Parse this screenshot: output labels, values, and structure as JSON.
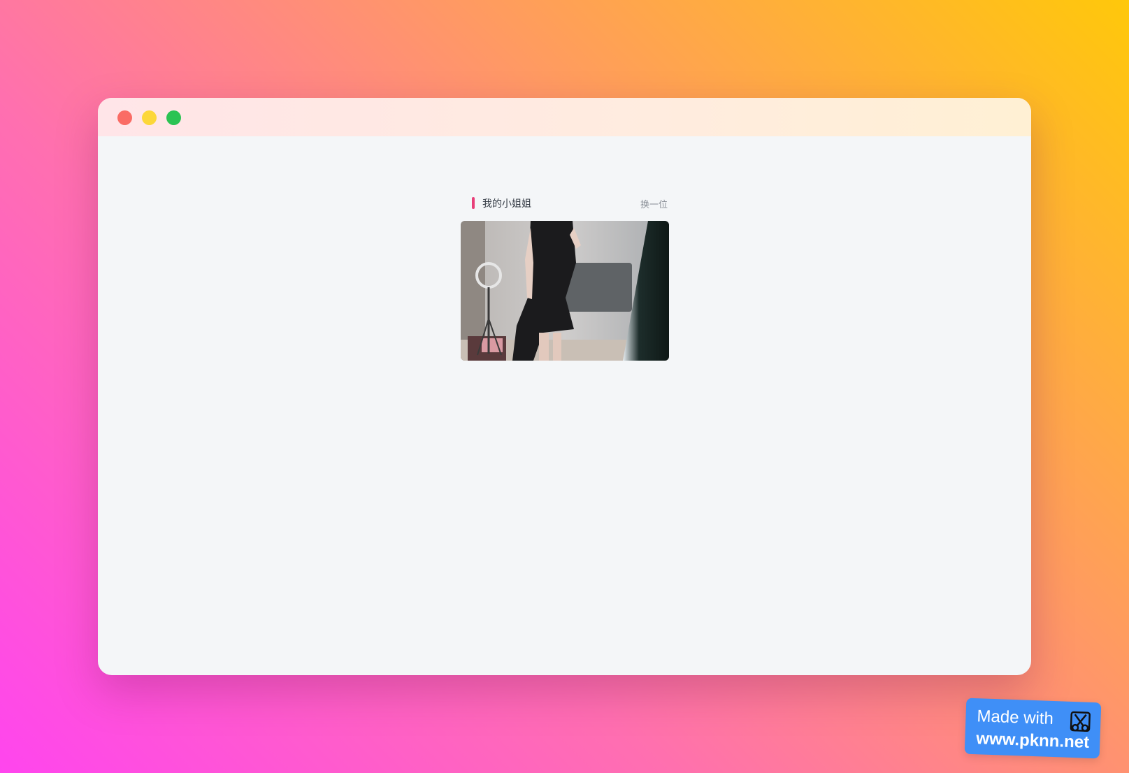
{
  "window": {
    "controls": [
      "close",
      "minimize",
      "maximize"
    ]
  },
  "card": {
    "title": "我的小姐姐",
    "change_label": "换一位",
    "accent_color": "#e8407a",
    "image": {
      "description_icon": "photo-icon"
    }
  },
  "badge": {
    "line1": "Made with",
    "line2": "www.pknn.net",
    "logo_icon": "scissors-icon"
  }
}
